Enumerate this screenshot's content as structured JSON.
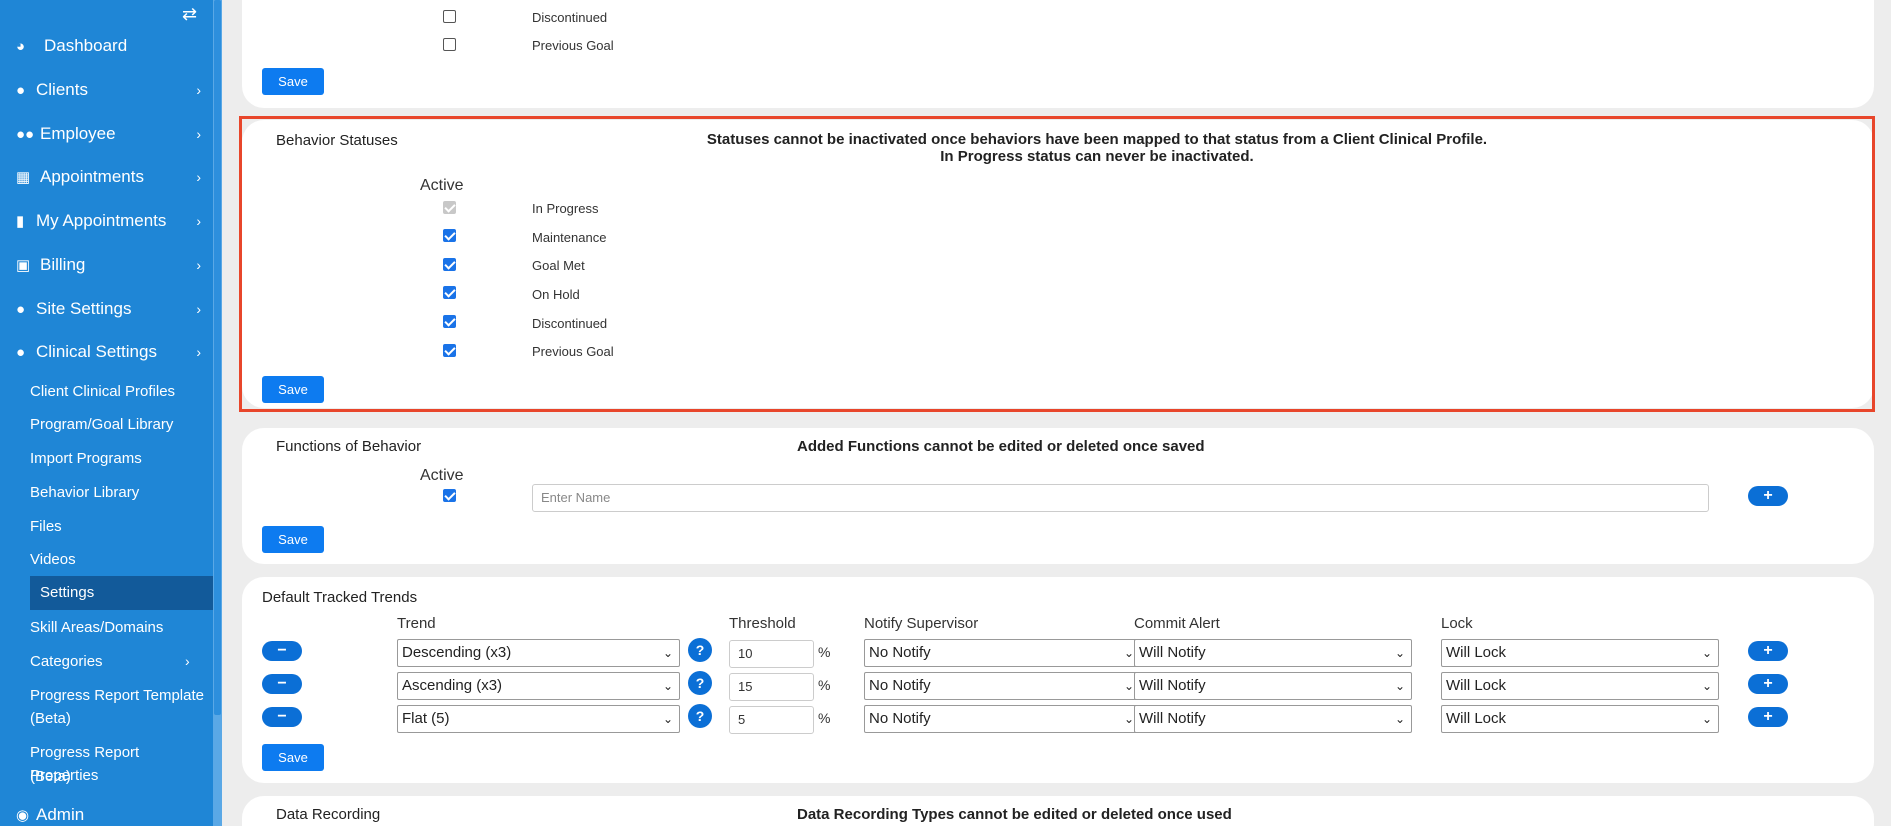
{
  "sidebar": {
    "toggle_icon": "⇄",
    "items": [
      {
        "label": "Dashboard",
        "icon": "tachometer-icon",
        "has_chevron": false
      },
      {
        "label": "Clients",
        "icon": "user-icon",
        "has_chevron": true
      },
      {
        "label": "Employee",
        "icon": "users-icon",
        "has_chevron": true
      },
      {
        "label": "Appointments",
        "icon": "calendar-icon",
        "has_chevron": true
      },
      {
        "label": "My Appointments",
        "icon": "book-icon",
        "has_chevron": true
      },
      {
        "label": "Billing",
        "icon": "money-icon",
        "has_chevron": true
      },
      {
        "label": "Site Settings",
        "icon": "user-icon",
        "has_chevron": true
      },
      {
        "label": "Clinical Settings",
        "icon": "user-icon",
        "has_chevron": true
      }
    ],
    "sub_items": [
      "Client Clinical Profiles",
      "Program/Goal Library",
      "Import Programs",
      "Behavior Library",
      "Files",
      "Videos",
      "Settings",
      "Skill Areas/Domains",
      "Categories",
      "Progress Report Template",
      "(Beta)",
      "Progress Report Properties",
      "(Beta)"
    ],
    "admin_label": "Admin"
  },
  "top_card": {
    "rows": [
      "Discontinued",
      "Previous Goal"
    ],
    "save_label": "Save"
  },
  "behavior_statuses": {
    "title": "Behavior Statuses",
    "note_line1": "Statuses cannot be inactivated once behaviors have been mapped to that status from a Client Clinical Profile.",
    "note_line2": "In Progress status can never be inactivated.",
    "active_header": "Active",
    "rows": [
      "In Progress",
      "Maintenance",
      "Goal Met",
      "On Hold",
      "Discontinued",
      "Previous Goal"
    ],
    "save_label": "Save"
  },
  "functions": {
    "title": "Functions of Behavior",
    "note": "Added Functions cannot be edited or deleted once saved",
    "active_header": "Active",
    "name_placeholder": "Enter Name",
    "add_icon": "+",
    "save_label": "Save"
  },
  "trends": {
    "title": "Default Tracked Trends",
    "headers": {
      "trend": "Trend",
      "threshold": "Threshold",
      "notify": "Notify Supervisor",
      "commit": "Commit Alert",
      "lock": "Lock"
    },
    "rows": [
      {
        "trend": "Descending (x3)",
        "threshold": "10",
        "notify": "No Notify",
        "commit": "Will Notify",
        "lock": "Will Lock"
      },
      {
        "trend": "Ascending (x3)",
        "threshold": "15",
        "notify": "No Notify",
        "commit": "Will Notify",
        "lock": "Will Lock"
      },
      {
        "trend": "Flat (5)",
        "threshold": "5",
        "notify": "No Notify",
        "commit": "Will Notify",
        "lock": "Will Lock"
      }
    ],
    "pct": "%",
    "help_glyph": "?",
    "remove_glyph": "−",
    "add_glyph": "+",
    "save_label": "Save"
  },
  "data_recording": {
    "title": "Data Recording",
    "note": "Data Recording Types cannot be edited or deleted once used"
  },
  "colors": {
    "sidebar": "#1f86d6",
    "highlight": "#e8462b",
    "button": "#0d7bf0"
  }
}
